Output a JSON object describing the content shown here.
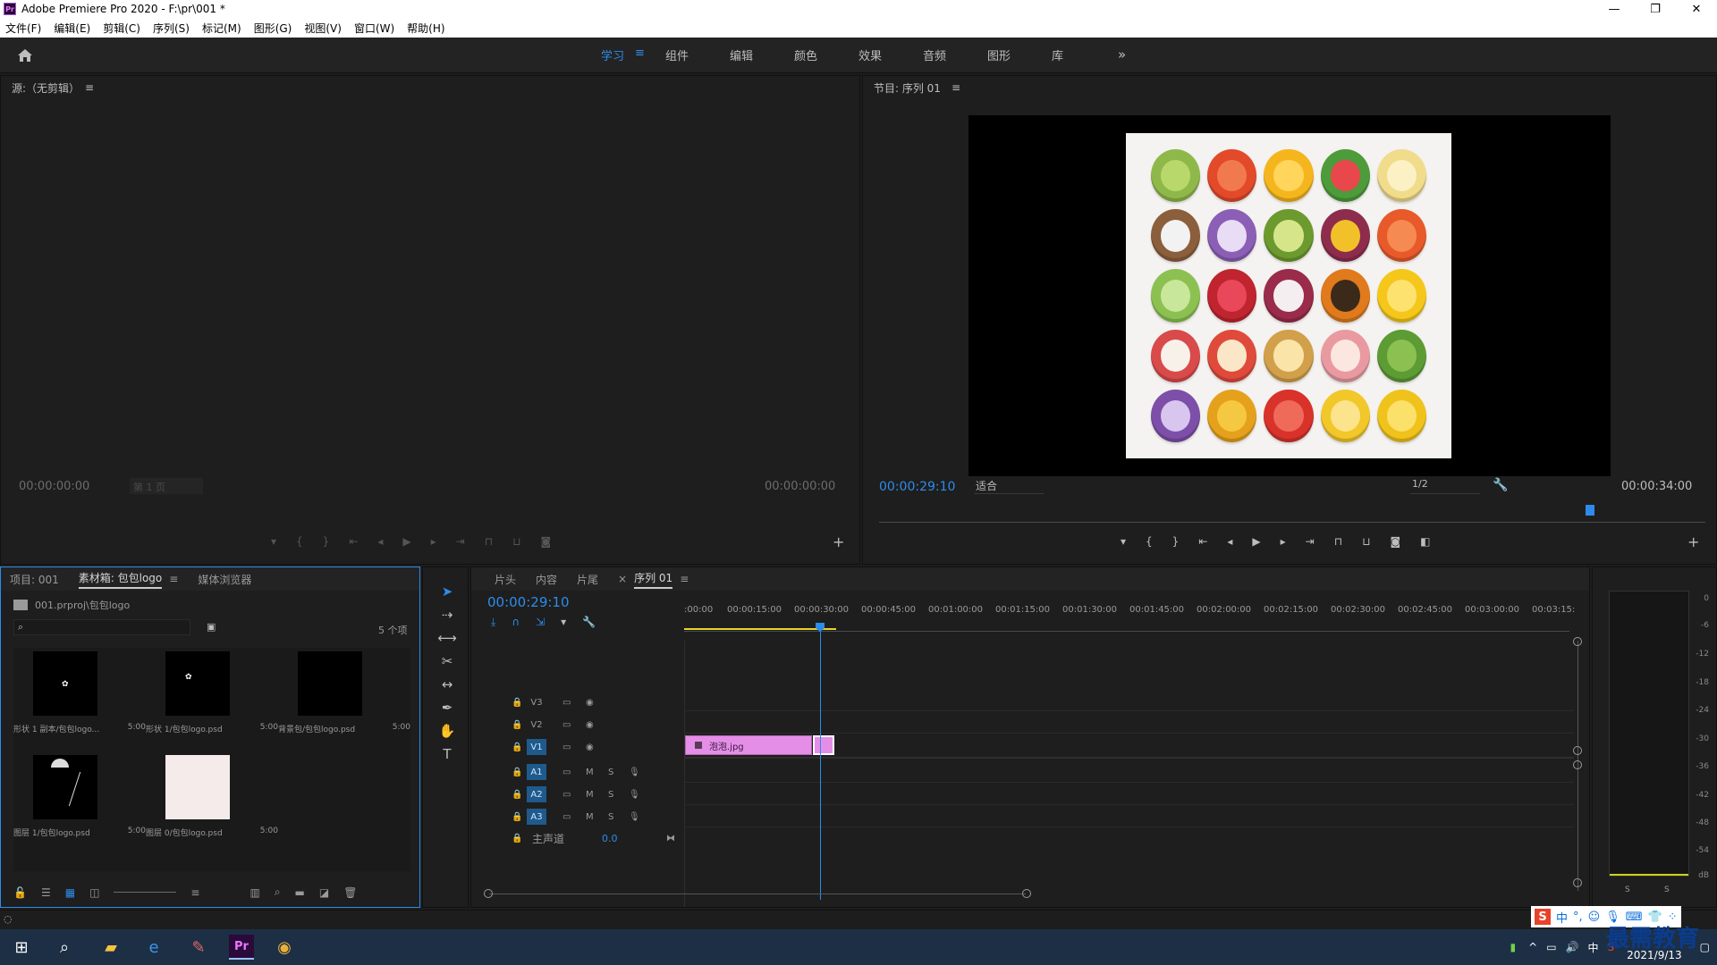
{
  "window": {
    "title": "Adobe Premiere Pro 2020 - F:\\pr\\001 *",
    "minimize": "—",
    "restore": "❐",
    "close": "✕"
  },
  "menu": [
    "文件(F)",
    "编辑(E)",
    "剪辑(C)",
    "序列(S)",
    "标记(M)",
    "图形(G)",
    "视图(V)",
    "窗口(W)",
    "帮助(H)"
  ],
  "workspaces": {
    "items": [
      "学习",
      "组件",
      "编辑",
      "颜色",
      "效果",
      "音频",
      "图形",
      "库"
    ],
    "active": "学习",
    "more": "»",
    "menu_icon": "≡"
  },
  "source": {
    "title": "源:（无剪辑）",
    "menu_icon": "≡",
    "tc_left": "00:00:00:00",
    "page": "第 1 页",
    "tc_right": "00:00:00:00"
  },
  "program": {
    "title": "节目: 序列 01",
    "menu_icon": "≡",
    "tc_current": "00:00:29:10",
    "fit": "适合",
    "resolution": "1/2",
    "tc_duration": "00:00:34:00"
  },
  "project": {
    "tabs": [
      "项目: 001",
      "素材箱: 包包logo",
      "媒体浏览器"
    ],
    "active_tab": "素材箱: 包包logo",
    "menu_icon": "≡",
    "path": "001.prproj\\包包logo",
    "count": "5 个项",
    "items": [
      {
        "name": "形状 1 副本/包包logo...",
        "dur": "5:00"
      },
      {
        "name": "形状 1/包包logo.psd",
        "dur": "5:00"
      },
      {
        "name": "背景包/包包logo.psd",
        "dur": "5:00"
      },
      {
        "name": "图层 1/包包logo.psd",
        "dur": "5:00"
      },
      {
        "name": "图层 0/包包logo.psd",
        "dur": "5:00"
      }
    ]
  },
  "timeline": {
    "tabs": [
      "片头",
      "内容",
      "片尾"
    ],
    "seq_tab": "序列 01",
    "close_icon": "×",
    "menu_icon": "≡",
    "tc": "00:00:29:10",
    "ruler": [
      ":00:00",
      "00:00:15:00",
      "00:00:30:00",
      "00:00:45:00",
      "00:01:00:00",
      "00:01:15:00",
      "00:01:30:00",
      "00:01:45:00",
      "00:02:00:00",
      "00:02:15:00",
      "00:02:30:00",
      "00:02:45:00",
      "00:03:00:00",
      "00:03:15:"
    ],
    "tracks": [
      "V3",
      "V2",
      "V1",
      "A1",
      "A2",
      "A3"
    ],
    "audio_m": "M",
    "audio_s": "S",
    "master": {
      "label": "主声道",
      "value": "0.0"
    },
    "clip": "泡泡.jpg"
  },
  "meter": {
    "labels": [
      "0",
      "-6",
      "-12",
      "-18",
      "-24",
      "-30",
      "-36",
      "-42",
      "-48",
      "-54",
      "dB"
    ],
    "solo": "S"
  },
  "taskbar": {
    "time": "2021/9/13",
    "lang": "中"
  },
  "watermark": "最需教育",
  "colors": {
    "accent": "#2d8ceb",
    "clip": "#e58ee8",
    "taskbar": "#1d2f45"
  }
}
